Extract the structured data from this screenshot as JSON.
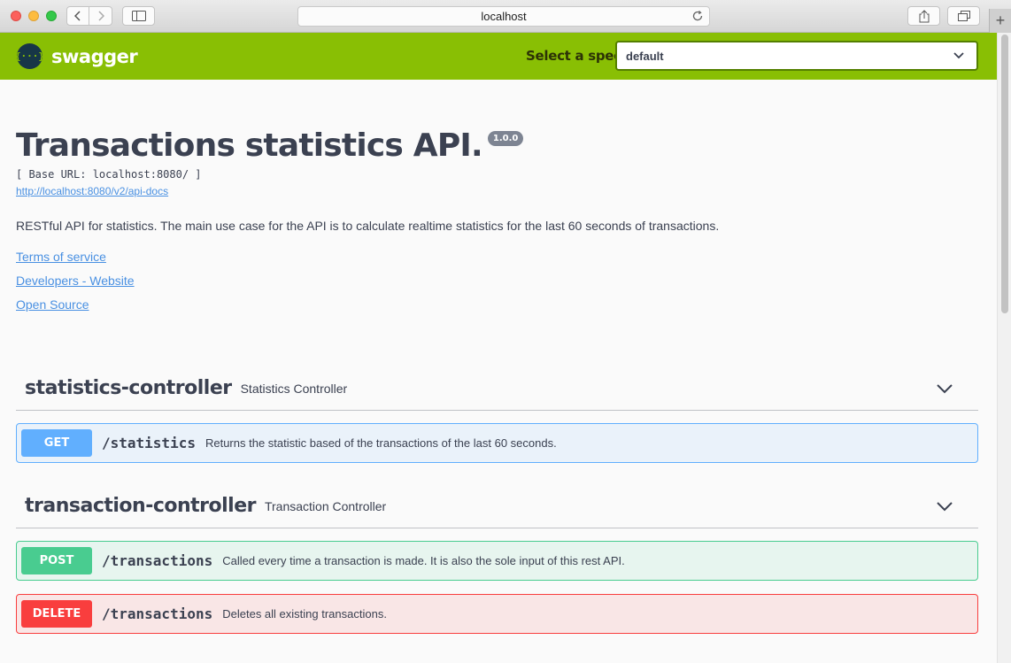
{
  "browser": {
    "address": "localhost",
    "new_tab": "+"
  },
  "topbar": {
    "logo_text": "swagger",
    "logo_symbol": "{···}",
    "spec_label": "Select a spec",
    "spec_value": "default"
  },
  "info": {
    "title": "Transactions statistics API.",
    "version": "1.0.0",
    "base_url": "[ Base URL: localhost:8080/ ]",
    "docs_link": "http://localhost:8080/v2/api-docs",
    "description": "RESTful API for statistics. The main use case for the API is to calculate realtime statistics for the last 60 seconds of transactions.",
    "links": [
      "Terms of service",
      "Developers - Website",
      "Open Source"
    ]
  },
  "tags": [
    {
      "name": "statistics-controller",
      "description": "Statistics Controller",
      "operations": [
        {
          "method": "GET",
          "path": "/statistics",
          "summary": "Returns the statistic based of the transactions of the last 60 seconds."
        }
      ]
    },
    {
      "name": "transaction-controller",
      "description": "Transaction Controller",
      "operations": [
        {
          "method": "POST",
          "path": "/transactions",
          "summary": "Called every time a transaction is made. It is also the sole input of this rest API."
        },
        {
          "method": "DELETE",
          "path": "/transactions",
          "summary": "Deletes all existing transactions."
        }
      ]
    }
  ],
  "colors": {
    "topbar": "#89bf04",
    "get": "#61affe",
    "post": "#49cc90",
    "delete": "#f93e3e",
    "link": "#4990e2"
  }
}
